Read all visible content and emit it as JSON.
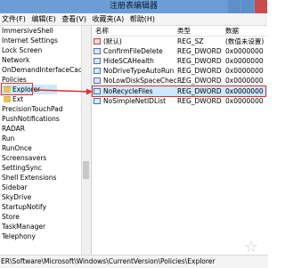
{
  "window": {
    "title": "注册表编辑器"
  },
  "menu": [
    "文件(F)",
    "编辑(E)",
    "查看(V)",
    "收藏夹(A)",
    "帮助(H)"
  ],
  "tree": [
    "ImmersiveShell",
    "Internet Settings",
    "Lock Screen",
    "Network",
    "OnDemandInterfaceCache",
    "Policies",
    "Explorer",
    "Ext",
    "PrecisionTouchPad",
    "PushNotifications",
    "RADAR",
    "Run",
    "RunOnce",
    "Screensavers",
    "SettingSync",
    "Shell Extensions",
    "Sidebar",
    "SkyDrive",
    "StartupNotify",
    "Store",
    "TaskManager",
    "Telephony"
  ],
  "columns": {
    "name": "名称",
    "type": "类型",
    "data": "数据"
  },
  "values": [
    {
      "name": "(默认)",
      "type": "REG_SZ",
      "data": "(数值未设置)",
      "icon": "string-value-icon"
    },
    {
      "name": "ConfirmFileDelete",
      "type": "REG_DWORD",
      "data": "0x0000000",
      "icon": "dword-value-icon"
    },
    {
      "name": "HideSCAHealth",
      "type": "REG_DWORD",
      "data": "0x0000000",
      "icon": "dword-value-icon"
    },
    {
      "name": "NoDriveTypeAutoRun",
      "type": "REG_DWORD",
      "data": "0x0000000",
      "icon": "dword-value-icon"
    },
    {
      "name": "NoLowDiskSpaceChec...",
      "type": "REG_DWORD",
      "data": "0x0000000",
      "icon": "dword-value-icon"
    },
    {
      "name": "NoRecycleFiles",
      "type": "REG_DWORD",
      "data": "0x0000000",
      "icon": "dword-value-icon"
    },
    {
      "name": "NoSimpleNetIDList",
      "type": "REG_DWORD",
      "data": "0x0000000",
      "icon": "dword-value-icon"
    }
  ],
  "status": {
    "path": "ER\\Software\\Microsoft\\Windows\\CurrentVersion\\Policies\\Explorer"
  },
  "colors": {
    "highlight": "#e0302a",
    "selection": "#cde8ff",
    "titlebar": "#6b9ed6"
  },
  "watermark_icon": "star-watermark-icon"
}
